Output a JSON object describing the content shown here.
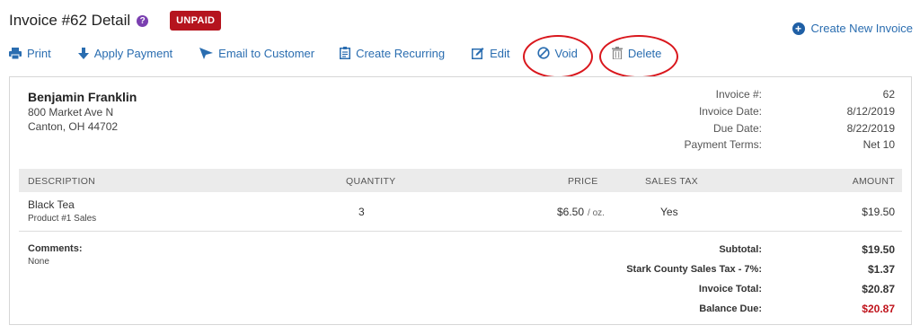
{
  "header": {
    "title": "Invoice #62 Detail",
    "help_icon_glyph": "?",
    "status": "UNPAID",
    "status_color": "#b5141e",
    "create_new_label": "Create New Invoice",
    "create_new_icon_glyph": "+"
  },
  "toolbar": {
    "print": "Print",
    "apply_payment": "Apply Payment",
    "email": "Email to Customer",
    "recurring": "Create Recurring",
    "edit": "Edit",
    "void": "Void",
    "delete": "Delete",
    "link_color": "#2a6db0",
    "highlight_color": "#d9161c"
  },
  "customer": {
    "name": "Benjamin Franklin",
    "address1": "800 Market Ave N",
    "address2": "Canton, OH 44702"
  },
  "meta": [
    {
      "label": "Invoice #:",
      "value": "62"
    },
    {
      "label": "Invoice Date:",
      "value": "8/12/2019"
    },
    {
      "label": "Due Date:",
      "value": "8/22/2019"
    },
    {
      "label": "Payment Terms:",
      "value": "Net 10"
    }
  ],
  "table": {
    "headers": {
      "description": "DESCRIPTION",
      "quantity": "QUANTITY",
      "price": "PRICE",
      "sales_tax": "SALES TAX",
      "amount": "AMOUNT"
    },
    "rows": [
      {
        "name": "Black Tea",
        "subtitle": "Product #1 Sales",
        "quantity": "3",
        "price": "$6.50",
        "unit": "/ oz.",
        "sales_tax": "Yes",
        "amount": "$19.50"
      }
    ]
  },
  "comments": {
    "label": "Comments:",
    "value": "None"
  },
  "totals": [
    {
      "label": "Subtotal:",
      "value": "$19.50"
    },
    {
      "label": "Stark County Sales Tax - 7%:",
      "value": "$1.37"
    },
    {
      "label": "Invoice Total:",
      "value": "$20.87"
    },
    {
      "label": "Balance Due:",
      "value": "$20.87"
    }
  ],
  "balance_due_color": "#c0141c"
}
